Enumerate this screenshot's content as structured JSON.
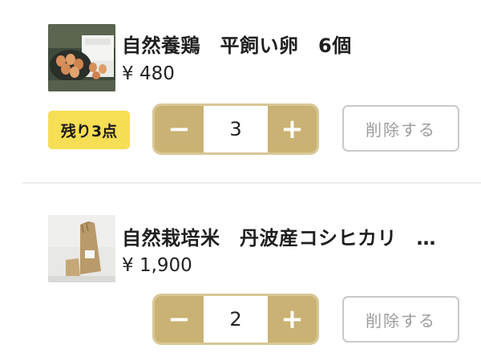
{
  "cart": {
    "items": [
      {
        "image": "eggs-carton-photo",
        "name": "自然養鶏　平飼い卵　6個",
        "price": "¥ 480",
        "stock_badge": "残り3点",
        "quantity": "3",
        "decrement_label": "−",
        "increment_label": "+",
        "delete_label": "削除する"
      },
      {
        "image": "rice-bag-photo",
        "name": "自然栽培米　丹波産コシヒカリ　…",
        "price": "¥ 1,900",
        "quantity": "2",
        "decrement_label": "−",
        "increment_label": "+",
        "delete_label": "削除する"
      }
    ]
  },
  "colors": {
    "stepper_gold": "#c9b273",
    "badge_yellow": "#f6de55",
    "delete_gray": "#9c9c9c"
  }
}
